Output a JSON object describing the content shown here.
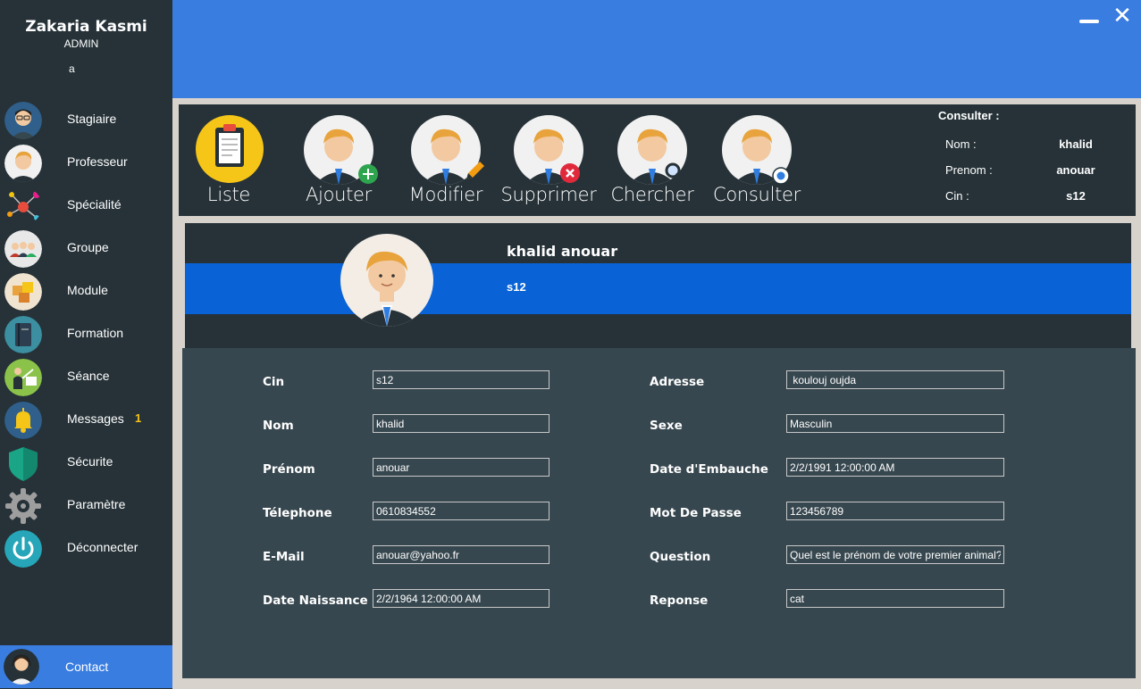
{
  "user": {
    "name": "Zakaria Kasmi",
    "role": "ADMIN",
    "extra": "a"
  },
  "sidebar": {
    "items": [
      {
        "label": "Stagiaire",
        "icon": "stagiaire-icon",
        "color": "#2f5f8a"
      },
      {
        "label": "Professeur",
        "icon": "professeur-icon",
        "color": "#f1f1f1"
      },
      {
        "label": "Spécialité",
        "icon": "specialite-icon",
        "color": "#263238"
      },
      {
        "label": "Groupe",
        "icon": "groupe-icon",
        "color": "#e8e8e8"
      },
      {
        "label": "Module",
        "icon": "module-icon",
        "color": "#f0e4d0"
      },
      {
        "label": "Formation",
        "icon": "formation-icon",
        "color": "#3b8fa0"
      },
      {
        "label": "Séance",
        "icon": "seance-icon",
        "color": "#8bc34a"
      },
      {
        "label": "Messages",
        "icon": "bell-icon",
        "color": "#2f5f8a",
        "badge": "1"
      },
      {
        "label": "Sécurite",
        "icon": "shield-icon",
        "color": "#1aa587"
      },
      {
        "label": "Paramètre",
        "icon": "gear-icon",
        "color": "#9e9e9e"
      },
      {
        "label": "Déconnecter",
        "icon": "power-icon",
        "color": "#26a6b8"
      }
    ],
    "contact": {
      "label": "Contact",
      "icon": "contact-icon"
    }
  },
  "toolbar": {
    "items": [
      {
        "label": "Liste",
        "icon": "clipboard-icon"
      },
      {
        "label": "Ajouter",
        "icon": "add-user-icon"
      },
      {
        "label": "Modifier",
        "icon": "edit-user-icon"
      },
      {
        "label": "Supprimer",
        "icon": "delete-user-icon"
      },
      {
        "label": "Chercher",
        "icon": "search-user-icon"
      },
      {
        "label": "Consulter",
        "icon": "view-user-icon"
      }
    ]
  },
  "consult": {
    "title": "Consulter :",
    "nom_label": "Nom :",
    "nom_value": "khalid",
    "prenom_label": "Prenom :",
    "prenom_value": "anouar",
    "cin_label": "Cin :",
    "cin_value": "s12"
  },
  "profile": {
    "full_name": "khalid anouar",
    "cin": "s12"
  },
  "form": {
    "cin_label": "Cin",
    "cin_value": "s12",
    "nom_label": "Nom",
    "nom_value": "khalid",
    "prenom_label": "Prénom",
    "prenom_value": "anouar",
    "telephone_label": "Télephone",
    "telephone_value": "0610834552",
    "email_label": "E-Mail",
    "email_value": "anouar@yahoo.fr",
    "naissance_label": "Date Naissance",
    "naissance_value": "2/2/1964 12:00:00 AM",
    "adresse_label": "Adresse",
    "adresse_value": " koulouj oujda",
    "sexe_label": "Sexe",
    "sexe_value": "Masculin",
    "embauche_label": "Date d'Embauche",
    "embauche_value": "2/2/1991 12:00:00 AM",
    "motdepasse_label": "Mot De Passe",
    "motdepasse_value": "123456789",
    "question_label": "Question",
    "question_value": "Quel est le prénom de votre premier animal?",
    "reponse_label": "Reponse",
    "reponse_value": "cat"
  },
  "colors": {
    "accent": "#3a7de0",
    "sidebar": "#263238",
    "banner": "#0a63d6",
    "form_bg": "#37474f",
    "badge": "#f5c518"
  }
}
